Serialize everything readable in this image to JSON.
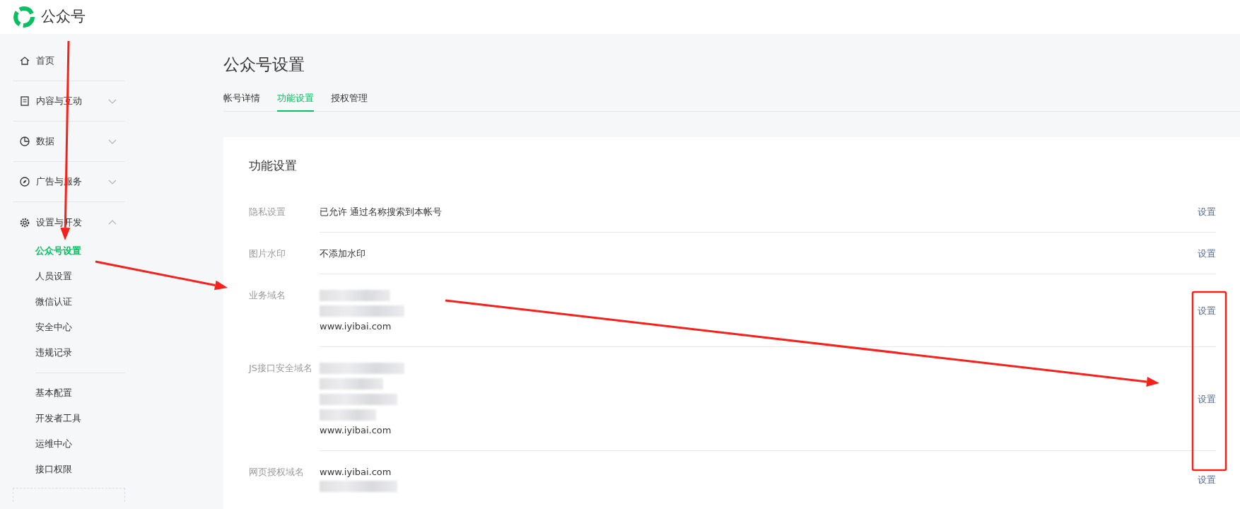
{
  "header": {
    "brand": "公众号"
  },
  "sidebar": {
    "items": [
      {
        "label": "首页"
      },
      {
        "label": "内容与互动",
        "expanded": false
      },
      {
        "label": "数据",
        "expanded": false
      },
      {
        "label": "广告与服务",
        "expanded": false
      },
      {
        "label": "设置与开发",
        "expanded": true,
        "children": [
          {
            "label": "公众号设置",
            "selected": true
          },
          {
            "label": "人员设置",
            "selected": false
          },
          {
            "label": "微信认证",
            "selected": false
          },
          {
            "label": "安全中心",
            "selected": false
          },
          {
            "label": "违规记录",
            "selected": false
          },
          {
            "kind": "divider"
          },
          {
            "label": "基本配置",
            "selected": false
          },
          {
            "label": "开发者工具",
            "selected": false
          },
          {
            "label": "运维中心",
            "selected": false
          },
          {
            "label": "接口权限",
            "selected": false
          }
        ]
      }
    ]
  },
  "page": {
    "title": "公众号设置",
    "tabs": [
      {
        "label": "帐号详情",
        "selected": false
      },
      {
        "label": "功能设置",
        "selected": true
      },
      {
        "label": "授权管理",
        "selected": false
      }
    ],
    "card": {
      "title": "功能设置",
      "rows": [
        {
          "label": "隐私设置",
          "values": [
            {
              "kind": "text",
              "text": "已允许 通过名称搜索到本帐号"
            }
          ],
          "action": "设置"
        },
        {
          "label": "图片水印",
          "values": [
            {
              "kind": "text",
              "text": "不添加水印"
            }
          ],
          "action": "设置"
        },
        {
          "label": "业务域名",
          "values": [
            {
              "kind": "redacted"
            },
            {
              "kind": "redacted"
            },
            {
              "kind": "text",
              "text": "www.iyibai.com"
            }
          ],
          "action": "设置"
        },
        {
          "label": "JS接口安全域名",
          "values": [
            {
              "kind": "redacted"
            },
            {
              "kind": "redacted"
            },
            {
              "kind": "redacted"
            },
            {
              "kind": "redacted"
            },
            {
              "kind": "text",
              "text": "www.iyibai.com"
            }
          ],
          "action": "设置"
        },
        {
          "label": "网页授权域名",
          "values": [
            {
              "kind": "text",
              "text": "www.iyibai.com"
            },
            {
              "kind": "redacted"
            }
          ],
          "action": "设置"
        }
      ]
    }
  },
  "annotations": [
    {
      "kind": "arrow"
    },
    {
      "kind": "arrow"
    },
    {
      "kind": "arrow"
    },
    {
      "kind": "box"
    }
  ]
}
